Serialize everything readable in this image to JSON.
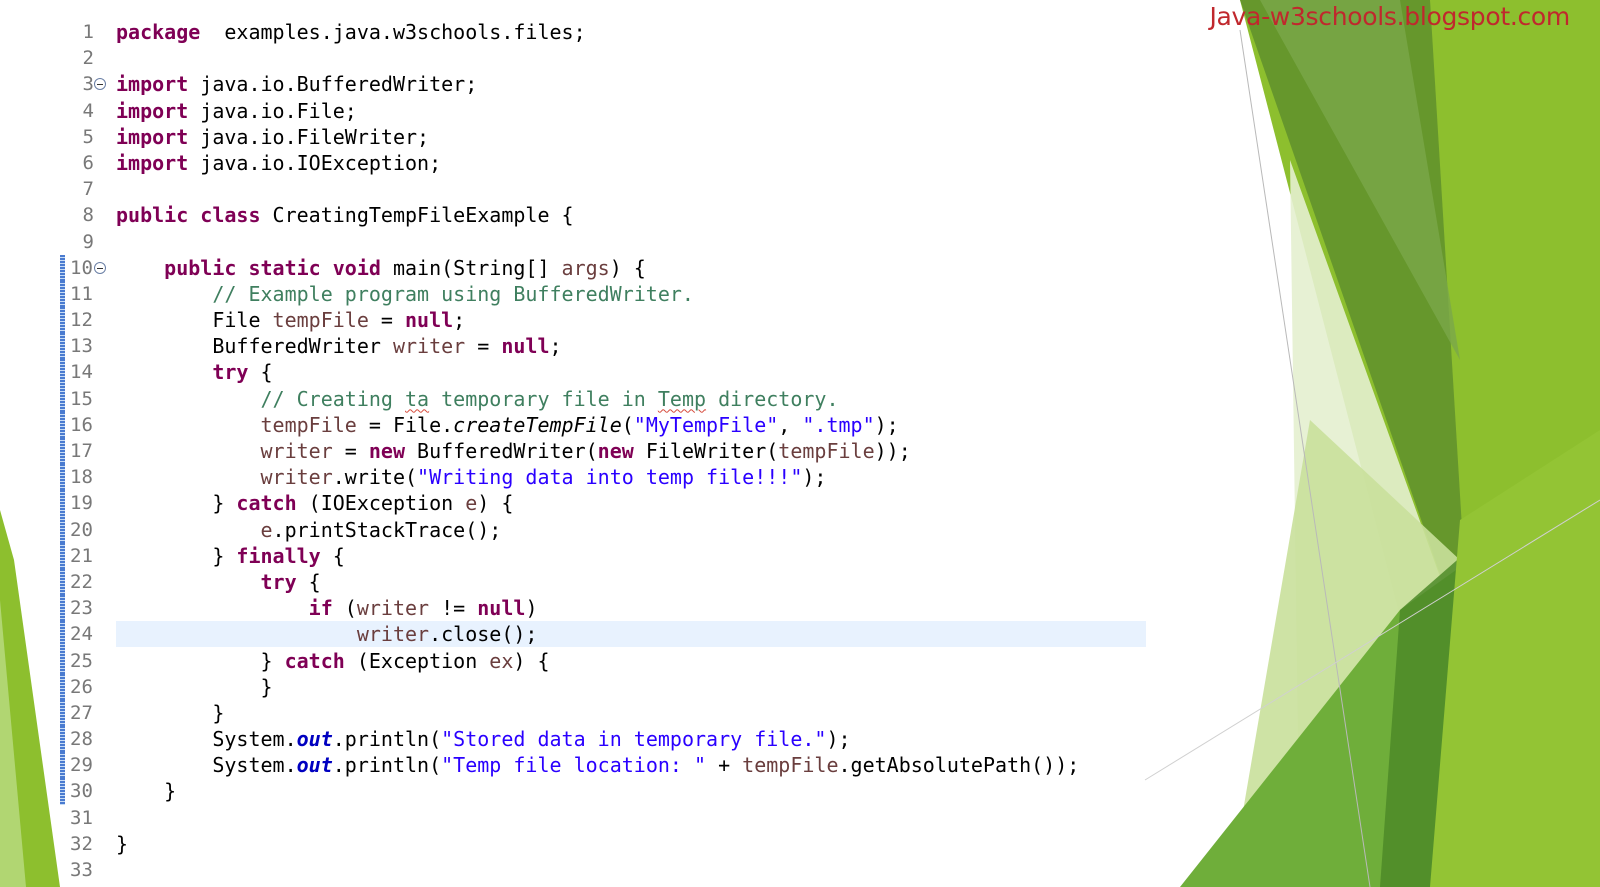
{
  "watermark": "Java-w3schools.blogspot.com",
  "colors": {
    "keyword": "#7f0055",
    "comment": "#3f7f5f",
    "string": "#2a00ff",
    "static_field": "#0000c0",
    "local_var": "#6a3e3e",
    "line_highlight": "#e8f2fe",
    "watermark": "#c0282d",
    "accent_green": "#8dbf2e"
  },
  "editor": {
    "highlighted_line": 24,
    "fold_markers": [
      3,
      10
    ],
    "lines": [
      {
        "n": "1",
        "t": [
          [
            "kw",
            "package"
          ],
          [
            "",
            "  examples.java.w3schools.files;"
          ]
        ]
      },
      {
        "n": "2",
        "t": []
      },
      {
        "n": "3",
        "t": [
          [
            "kw",
            "import"
          ],
          [
            "",
            " java.io.BufferedWriter;"
          ]
        ]
      },
      {
        "n": "4",
        "t": [
          [
            "kw",
            "import"
          ],
          [
            "",
            " java.io.File;"
          ]
        ]
      },
      {
        "n": "5",
        "t": [
          [
            "kw",
            "import"
          ],
          [
            "",
            " java.io.FileWriter;"
          ]
        ]
      },
      {
        "n": "6",
        "t": [
          [
            "kw",
            "import"
          ],
          [
            "",
            " java.io.IOException;"
          ]
        ]
      },
      {
        "n": "7",
        "t": []
      },
      {
        "n": "8",
        "t": [
          [
            "kw",
            "public class"
          ],
          [
            "",
            " CreatingTempFileExample {"
          ]
        ]
      },
      {
        "n": "9",
        "t": []
      },
      {
        "n": "10",
        "t": [
          [
            "",
            "    "
          ],
          [
            "kw",
            "public static void"
          ],
          [
            "",
            " main(String[] "
          ],
          [
            "va",
            "args"
          ],
          [
            "",
            ") {"
          ]
        ]
      },
      {
        "n": "11",
        "t": [
          [
            "",
            "        "
          ],
          [
            "cm",
            "// Example program using BufferedWriter."
          ]
        ]
      },
      {
        "n": "12",
        "t": [
          [
            "",
            "        File "
          ],
          [
            "va",
            "tempFile"
          ],
          [
            "",
            " = "
          ],
          [
            "kw",
            "null"
          ],
          [
            "",
            ";"
          ]
        ]
      },
      {
        "n": "13",
        "t": [
          [
            "",
            "        BufferedWriter "
          ],
          [
            "va",
            "writer"
          ],
          [
            "",
            " = "
          ],
          [
            "kw",
            "null"
          ],
          [
            "",
            ";"
          ]
        ]
      },
      {
        "n": "14",
        "t": [
          [
            "",
            "        "
          ],
          [
            "kw",
            "try"
          ],
          [
            "",
            " {"
          ]
        ]
      },
      {
        "n": "15",
        "t": [
          [
            "",
            "            "
          ],
          [
            "cm",
            "// Creating "
          ],
          [
            "cm sq",
            "ta"
          ],
          [
            "cm",
            " temporary file in "
          ],
          [
            "cm sq",
            "Temp"
          ],
          [
            "cm",
            " directory."
          ]
        ]
      },
      {
        "n": "16",
        "t": [
          [
            "",
            "            "
          ],
          [
            "va",
            "tempFile"
          ],
          [
            "",
            " = File."
          ],
          [
            "it",
            "createTempFile"
          ],
          [
            "",
            "("
          ],
          [
            "st",
            "\"MyTempFile\""
          ],
          [
            "",
            ", "
          ],
          [
            "st",
            "\".tmp\""
          ],
          [
            "",
            ");"
          ]
        ]
      },
      {
        "n": "17",
        "t": [
          [
            "",
            "            "
          ],
          [
            "va",
            "writer"
          ],
          [
            "",
            " = "
          ],
          [
            "kw",
            "new"
          ],
          [
            "",
            " BufferedWriter("
          ],
          [
            "kw",
            "new"
          ],
          [
            "",
            " FileWriter("
          ],
          [
            "va",
            "tempFile"
          ],
          [
            "",
            "));"
          ]
        ]
      },
      {
        "n": "18",
        "t": [
          [
            "",
            "            "
          ],
          [
            "va",
            "writer"
          ],
          [
            "",
            ".write("
          ],
          [
            "st",
            "\"Writing data into temp file!!!\""
          ],
          [
            "",
            ");"
          ]
        ]
      },
      {
        "n": "19",
        "t": [
          [
            "",
            "        } "
          ],
          [
            "kw",
            "catch"
          ],
          [
            "",
            " (IOException "
          ],
          [
            "va",
            "e"
          ],
          [
            "",
            ") {"
          ]
        ]
      },
      {
        "n": "20",
        "t": [
          [
            "",
            "            "
          ],
          [
            "va",
            "e"
          ],
          [
            "",
            ".printStackTrace();"
          ]
        ]
      },
      {
        "n": "21",
        "t": [
          [
            "",
            "        } "
          ],
          [
            "kw",
            "finally"
          ],
          [
            "",
            " {"
          ]
        ]
      },
      {
        "n": "22",
        "t": [
          [
            "",
            "            "
          ],
          [
            "kw",
            "try"
          ],
          [
            "",
            " {"
          ]
        ]
      },
      {
        "n": "23",
        "t": [
          [
            "",
            "                "
          ],
          [
            "kw",
            "if"
          ],
          [
            "",
            " ("
          ],
          [
            "va",
            "writer"
          ],
          [
            "",
            " != "
          ],
          [
            "kw",
            "null"
          ],
          [
            "",
            ")"
          ]
        ]
      },
      {
        "n": "24",
        "t": [
          [
            "",
            "                    "
          ],
          [
            "va",
            "writer"
          ],
          [
            "",
            ".close();"
          ]
        ]
      },
      {
        "n": "25",
        "t": [
          [
            "",
            "            } "
          ],
          [
            "kw",
            "catch"
          ],
          [
            "",
            " (Exception "
          ],
          [
            "va",
            "ex"
          ],
          [
            "",
            ") {"
          ]
        ]
      },
      {
        "n": "26",
        "t": [
          [
            "",
            "            }"
          ]
        ]
      },
      {
        "n": "27",
        "t": [
          [
            "",
            "        }"
          ]
        ]
      },
      {
        "n": "28",
        "t": [
          [
            "",
            "        System."
          ],
          [
            "fd",
            "out"
          ],
          [
            "",
            ".println("
          ],
          [
            "st",
            "\"Stored data in temporary file.\""
          ],
          [
            "",
            ");"
          ]
        ]
      },
      {
        "n": "29",
        "t": [
          [
            "",
            "        System."
          ],
          [
            "fd",
            "out"
          ],
          [
            "",
            ".println("
          ],
          [
            "st",
            "\"Temp file location: \""
          ],
          [
            "",
            " + "
          ],
          [
            "va",
            "tempFile"
          ],
          [
            "",
            ".getAbsolutePath());"
          ]
        ]
      },
      {
        "n": "30",
        "t": [
          [
            "",
            "    }"
          ]
        ]
      },
      {
        "n": "31",
        "t": []
      },
      {
        "n": "32",
        "t": [
          [
            "",
            "}"
          ]
        ]
      },
      {
        "n": "33",
        "t": []
      }
    ]
  }
}
